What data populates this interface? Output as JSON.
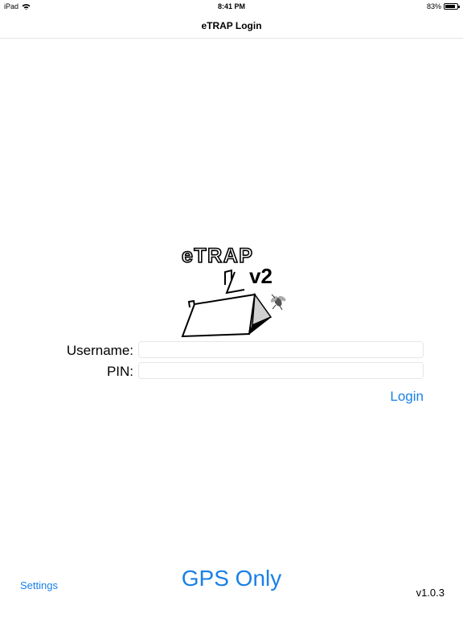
{
  "status_bar": {
    "device": "iPad",
    "time": "8:41 PM",
    "battery": "83%",
    "battery_level": 0.83,
    "wifi_icon": "wifi-icon",
    "battery_icon": "battery-icon"
  },
  "nav": {
    "title": "eTRAP Login"
  },
  "logo": {
    "text": "eTRAP",
    "version_mark": "v2"
  },
  "form": {
    "username_label": "Username:",
    "username_value": "",
    "pin_label": "PIN:",
    "pin_value": "",
    "login_label": "Login"
  },
  "footer": {
    "settings_label": "Settings",
    "gps_label": "GPS Only",
    "version": "v1.0.3"
  },
  "colors": {
    "accent": "#1a80e6",
    "background": "#ffffff",
    "input_border": "#e6e6e6"
  }
}
